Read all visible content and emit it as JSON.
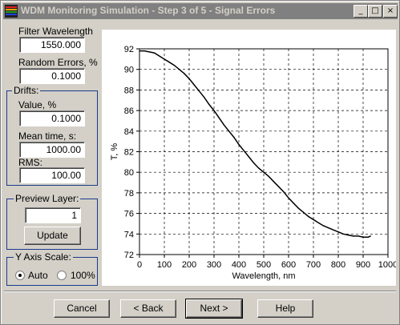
{
  "window": {
    "title": "WDM Monitoring Simulation - Step 3 of 5 - Signal Errors",
    "controls": [
      "_",
      "□",
      "×"
    ]
  },
  "left_panel": {
    "filter_wavelength": {
      "label": "Filter Wavelength",
      "value": "1550.000"
    },
    "random_errors": {
      "label": "Random Errors, %",
      "value": "0.1000"
    },
    "drifts": {
      "title": "Drifts:",
      "value": {
        "label": "Value, %",
        "value": "0.1000"
      },
      "mean_time": {
        "label": "Mean time, s:",
        "value": "1000.00"
      },
      "rms": {
        "label": "RMS:",
        "value": "100.00"
      }
    },
    "preview_layer": {
      "title": "Preview Layer:",
      "value": "1",
      "update_label": "Update"
    },
    "y_axis_scale": {
      "title": "Y Axis Scale:",
      "auto_label": "Auto",
      "pct_label": "100%",
      "selected": "Auto"
    }
  },
  "buttons": {
    "cancel": "Cancel",
    "back": "< Back",
    "next": "Next >",
    "help": "Help"
  },
  "chart_data": {
    "type": "line",
    "title": "",
    "xlabel": "Wavelength, nm",
    "ylabel": "T, %",
    "xlim": [
      0,
      1000
    ],
    "ylim": [
      72,
      92
    ],
    "xticks": [
      0,
      100,
      200,
      300,
      400,
      500,
      600,
      700,
      800,
      900,
      1000
    ],
    "yticks": [
      72,
      74,
      76,
      78,
      80,
      82,
      84,
      86,
      88,
      90,
      92
    ],
    "grid": true,
    "color": "#000000",
    "series": [
      {
        "x": [
          0,
          20,
          40,
          60,
          80,
          100,
          120,
          140,
          160,
          180,
          200,
          220,
          240,
          260,
          280,
          300,
          320,
          340,
          360,
          380,
          400,
          420,
          440,
          460,
          480,
          500,
          520,
          540,
          560,
          580,
          600,
          620,
          640,
          660,
          680,
          700,
          720,
          740,
          760,
          780,
          800,
          820,
          840,
          860,
          880,
          900,
          920,
          930
        ],
        "y": [
          91.8,
          91.8,
          91.7,
          91.6,
          91.3,
          91.0,
          90.7,
          90.4,
          90.0,
          89.6,
          89.1,
          88.5,
          87.9,
          87.3,
          86.6,
          86.0,
          85.3,
          84.6,
          84.0,
          83.4,
          82.7,
          82.1,
          81.5,
          80.9,
          80.4,
          80.0,
          79.6,
          79.1,
          78.6,
          78.1,
          77.5,
          77.0,
          76.5,
          76.1,
          75.7,
          75.4,
          75.1,
          74.8,
          74.6,
          74.4,
          74.2,
          74.0,
          73.9,
          73.8,
          73.8,
          73.7,
          73.7,
          73.8
        ]
      }
    ]
  }
}
